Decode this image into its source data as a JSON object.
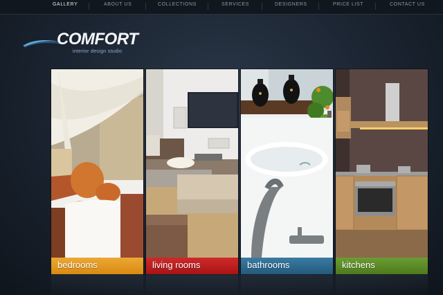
{
  "nav": {
    "items": [
      {
        "label": "GALLERY",
        "active": true
      },
      {
        "label": "ABOUT US",
        "active": false
      },
      {
        "label": "COLLECTIONS",
        "active": false
      },
      {
        "label": "SERVICES",
        "active": false
      },
      {
        "label": "DESIGNERS",
        "active": false
      },
      {
        "label": "PRICE LIST",
        "active": false
      },
      {
        "label": "CONTACT US",
        "active": false
      }
    ]
  },
  "logo": {
    "title": "COMFORT",
    "subtitle": "interior design studio"
  },
  "panels": [
    {
      "label": "bedrooms",
      "bar_color": "#e39a1c"
    },
    {
      "label": "living rooms",
      "bar_color": "#b81d1d"
    },
    {
      "label": "bathrooms",
      "bar_color": "#2f6c91"
    },
    {
      "label": "kitchens",
      "bar_color": "#5a8a26"
    }
  ]
}
